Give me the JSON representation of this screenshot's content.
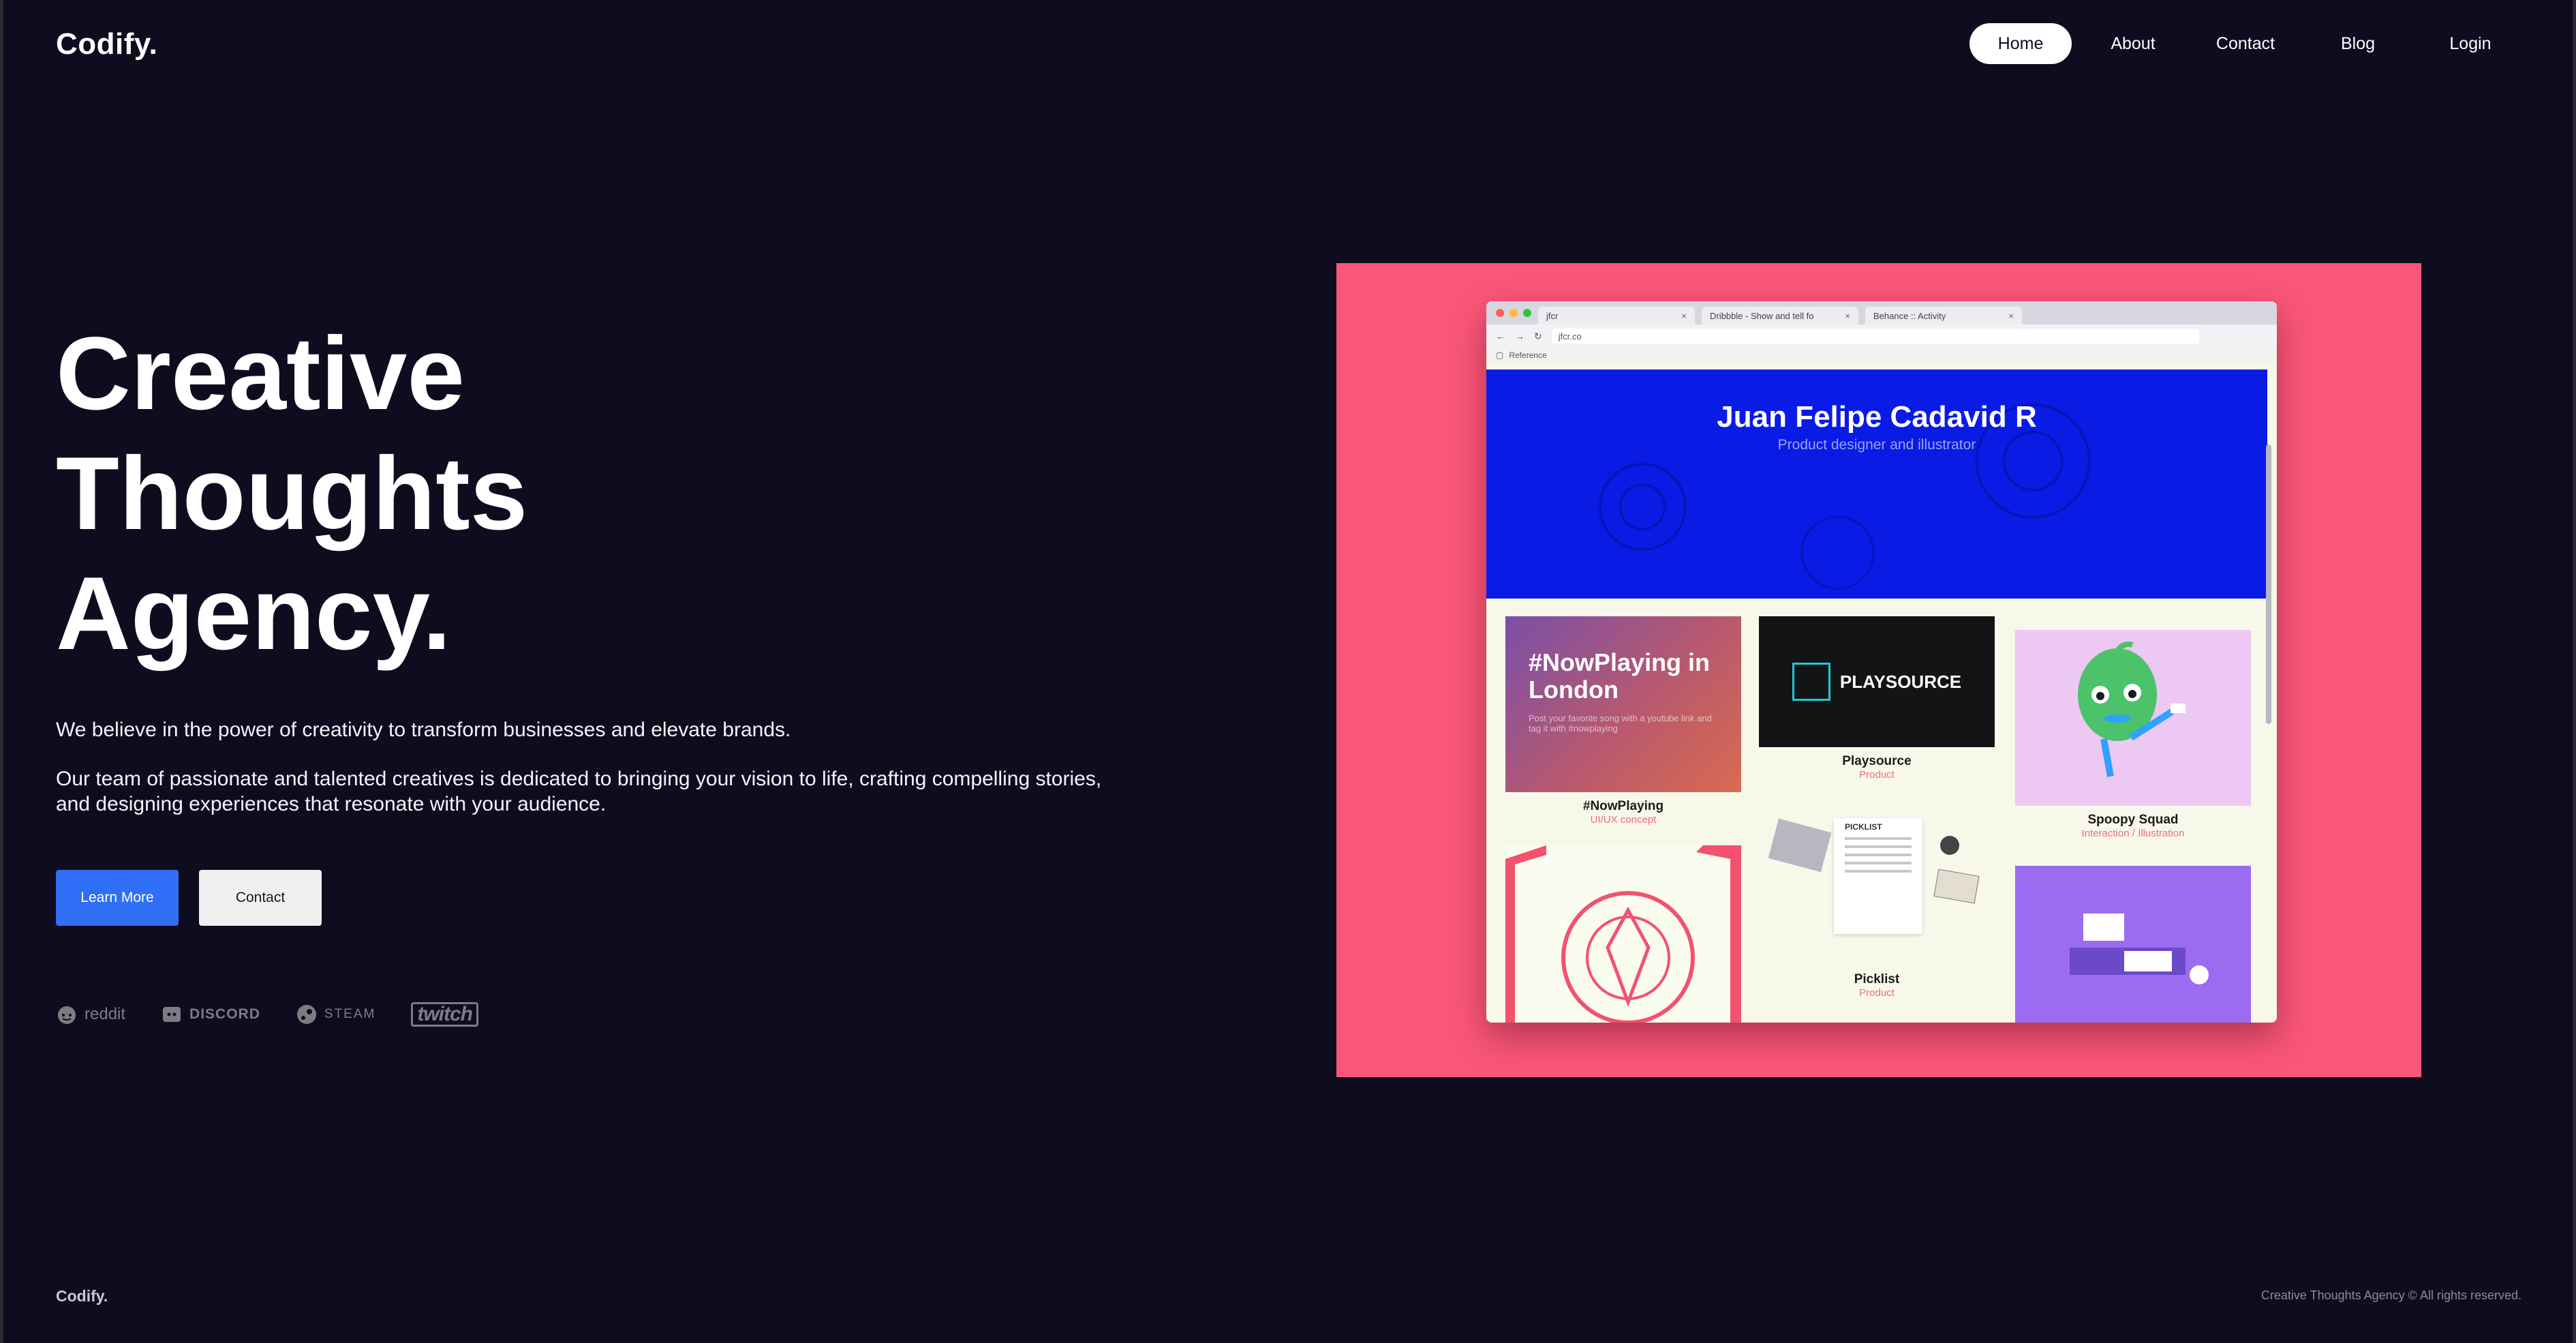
{
  "header": {
    "logo": "Codify.",
    "nav": [
      "Home",
      "About",
      "Contact",
      "Blog",
      "Login"
    ],
    "active_nav": "Home"
  },
  "hero": {
    "title_lines": [
      "Creative",
      "Thoughts",
      "Agency."
    ],
    "paragraph_1": "We believe in the power of creativity to transform businesses and elevate brands.",
    "paragraph_2": "Our team of passionate and talented creatives is dedicated to bringing your vision to life, crafting compelling stories, and designing experiences that resonate with your audience.",
    "primary_button": "Learn More",
    "secondary_button": "Contact"
  },
  "partners": [
    {
      "name": "reddit",
      "icon": "reddit-icon"
    },
    {
      "name": "DISCORD",
      "icon": "discord-icon"
    },
    {
      "name": "STEAM",
      "icon": "steam-icon"
    },
    {
      "name": "twitch",
      "icon": "twitch-icon"
    }
  ],
  "showcase": {
    "background": "#fa5778",
    "browser": {
      "tabs": [
        "jfcr",
        "Dribbble - Show and tell fo",
        "Behance :: Activity"
      ],
      "url": "jfcr.co",
      "bookmark": "Reference"
    },
    "profile": {
      "name": "Juan Felipe Cadavid R",
      "role": "Product designer and illustrator"
    },
    "cards": [
      {
        "title": "#NowPlaying",
        "subtitle": "UI/UX concept",
        "image_heading": "#NowPlaying in London",
        "image_text": "Post your favorite song with a youtube link and tag it with #nowplaying"
      },
      {
        "title": "Playsource",
        "subtitle": "Product",
        "image_heading": "PLAYSOURCE"
      },
      {
        "title": "Spoopy Squad",
        "subtitle": "Interaction / Illustration"
      },
      {
        "title": "Picklist",
        "subtitle": "Product",
        "image_heading": "PICKLIST"
      }
    ]
  },
  "footer": {
    "logo": "Codify.",
    "copyright": "Creative Thoughts Agency © All rights reserved."
  },
  "colors": {
    "background": "#0e0d1f",
    "primary": "#2f6ff5",
    "showcase_pink": "#fa5778",
    "profile_blue": "#0a1be6"
  }
}
